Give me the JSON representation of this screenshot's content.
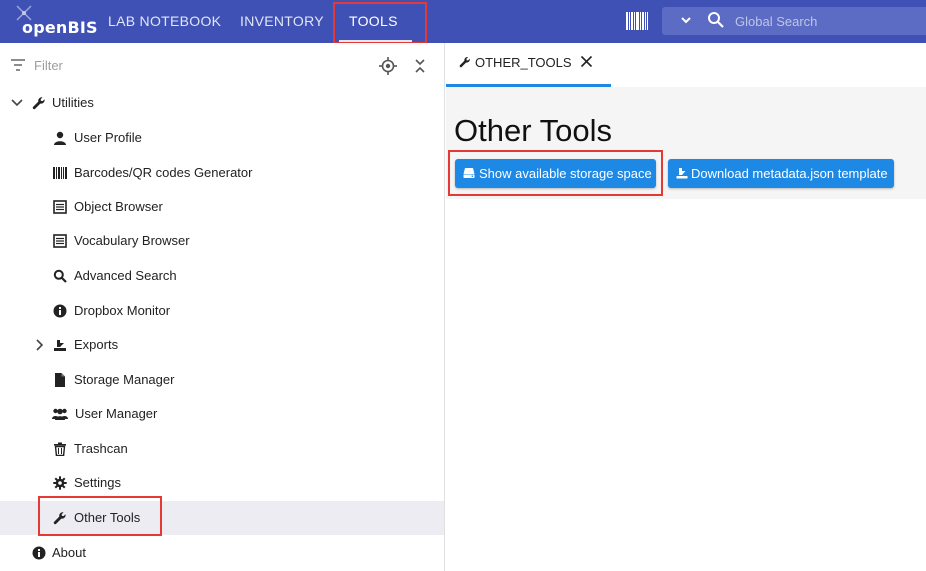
{
  "app": {
    "logo_text": "openBIS",
    "colors": {
      "topbar": "#3f51b5",
      "accent": "#1e88e5",
      "highlight": "#e53935"
    }
  },
  "nav": {
    "tabs": [
      {
        "label": "LAB NOTEBOOK"
      },
      {
        "label": "INVENTORY"
      },
      {
        "label": "TOOLS",
        "active": true
      }
    ]
  },
  "search": {
    "placeholder": "Global Search",
    "icon": "search-icon"
  },
  "sidebar": {
    "filter_placeholder": "Filter",
    "root": {
      "label": "Utilities",
      "expanded": true
    },
    "items": [
      {
        "label": "User Profile",
        "icon": "user-icon"
      },
      {
        "label": "Barcodes/QR codes Generator",
        "icon": "barcode-icon"
      },
      {
        "label": "Object Browser",
        "icon": "list-icon"
      },
      {
        "label": "Vocabulary Browser",
        "icon": "list-icon"
      },
      {
        "label": "Advanced Search",
        "icon": "search-icon"
      },
      {
        "label": "Dropbox Monitor",
        "icon": "info-icon"
      },
      {
        "label": "Exports",
        "icon": "export-icon",
        "expandable": true
      },
      {
        "label": "Storage Manager",
        "icon": "file-icon"
      },
      {
        "label": "User Manager",
        "icon": "users-icon"
      },
      {
        "label": "Trashcan",
        "icon": "trash-icon"
      },
      {
        "label": "Settings",
        "icon": "gear-icon"
      },
      {
        "label": "Other Tools",
        "icon": "wrench-icon",
        "selected": true
      }
    ],
    "about": {
      "label": "About",
      "icon": "info-icon"
    }
  },
  "main": {
    "tab": {
      "label": "OTHER_TOOLS"
    },
    "title": "Other Tools",
    "buttons": {
      "storage": "Show available storage space",
      "download": "Download metadata.json template"
    }
  }
}
